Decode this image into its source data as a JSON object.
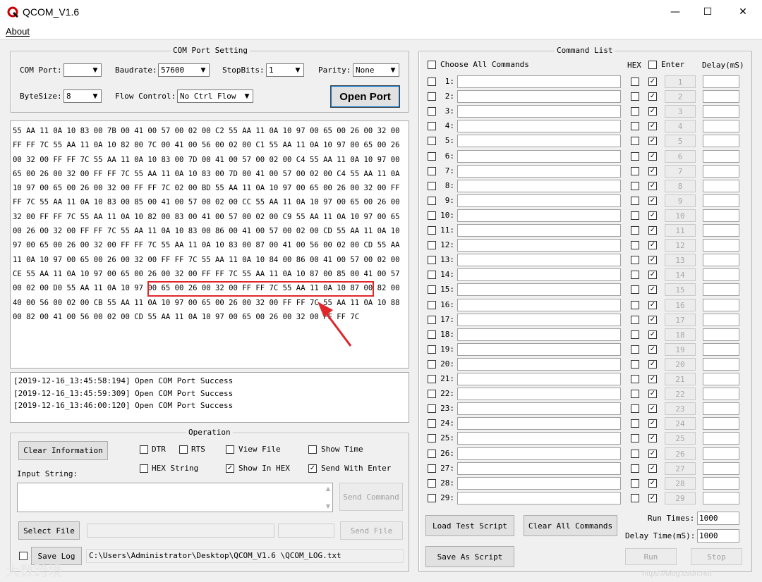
{
  "window": {
    "title": "QCOM_V1.6",
    "minimize": "—",
    "maximize": "☐",
    "close": "✕"
  },
  "menu": {
    "about": "About"
  },
  "com_setting": {
    "group_title": "COM Port Setting",
    "com_port_label": "COM Port:",
    "com_port_value": "",
    "baudrate_label": "Baudrate:",
    "baudrate_value": "57600",
    "stopbits_label": "StopBits:",
    "stopbits_value": "1",
    "parity_label": "Parity:",
    "parity_value": "None",
    "bytesize_label": "ByteSize:",
    "bytesize_value": "8",
    "flow_label": "Flow Control:",
    "flow_value": "No Ctrl Flow",
    "open_button": "Open Port"
  },
  "receive": {
    "lines": [
      "55 AA 11 0A 10 83 00 7B 00 41 00 57 00 02 00 C2 55 AA 11 0A 10 97 00 65 00 26 00 32 00",
      "FF FF 7C 55 AA 11 0A 10 82 00 7C 00 41 00 56 00 02 00 C1 55 AA 11 0A 10 97 00 65 00 26",
      "00 32 00 FF FF 7C 55 AA 11 0A 10 83 00 7D 00 41 00 57 00 02 00 C4 55 AA 11 0A 10 97 00",
      "65 00 26 00 32 00 FF FF 7C 55 AA 11 0A 10 83 00 7D 00 41 00 57 00 02 00 C4 55 AA 11 0A",
      "10 97 00 65 00 26 00 32 00 FF FF 7C 02 00 BD 55 AA 11 0A 10 97 00 65 00 26 00 32 00 FF",
      "FF 7C 55 AA 11 0A 10 83 00 85 00 41 00 57 00 02 00 CC 55 AA 11 0A 10 97 00 65 00 26 00",
      "32 00 FF FF 7C 55 AA 11 0A 10 82 00 83 00 41 00 57 00 02 00 C9 55 AA 11 0A 10 97 00 65",
      "00 26 00 32 00 FF FF 7C 55 AA 11 0A 10 83 00 86 00 41 00 57 00 02 00 CD 55 AA 11 0A 10",
      "97 00 65 00 26 00 32 00 FF FF 7C 55 AA 11 0A 10 83 00 87 00 41 00 56 00 02 00 CD 55 AA",
      "11 0A 10 97 00 65 00 26 00 32 00 FF FF 7C 55 AA 11 0A 10 84 00 86 00 41 00 57 00 02 00",
      "CE 55 AA 11 0A 10 97 00 65 00 26 00 32 00 FF FF 7C 55 AA 11 0A 10 87 00 85 00 41 00 57",
      "00 02 00 D0 55 AA 11 0A 10 97 00 65 00 26 00 32 00 FF FF 7C 55 AA 11 0A 10 87 00 82 00",
      "40 00 56 00 02 00 CB 55 AA 11 0A 10 97 00 65 00 26 00 32 00 FF FF 7C 55 AA 11 0A 10 88",
      "00 82 00 41 00 56 00 02 00 CD 55 AA 11 0A 10 97 00 65 00 26 00 32 00 FF FF 7C"
    ],
    "highlight_color": "#e0262a"
  },
  "log": {
    "lines": [
      "[2019-12-16_13:45:58:194] Open COM Port Success",
      "[2019-12-16_13:45:59:309] Open COM Port Success",
      "[2019-12-16_13:46:00:120] Open COM Port Success"
    ]
  },
  "operation": {
    "group_title": "Operation",
    "clear_button": "Clear Information",
    "dtr": "DTR",
    "rts": "RTS",
    "view_file": "View File",
    "show_time": "Show Time",
    "hex_string": "HEX String",
    "show_in_hex": "Show In HEX",
    "send_with_enter": "Send With Enter",
    "input_label": "Input String:",
    "send_command": "Send Command",
    "select_file": "Select File",
    "send_file": "Send File",
    "save_log": "Save Log",
    "log_path": "C:\\Users\\Administrator\\Desktop\\QCOM_V1.6 \\QCOM_LOG.txt"
  },
  "command_list": {
    "group_title": "Command List",
    "choose_all": "Choose All Commands",
    "hex_header": "HEX",
    "enter_header": "Enter",
    "delay_header": "Delay(mS)",
    "rows": [
      "1:",
      "2:",
      "3:",
      "4:",
      "5:",
      "6:",
      "7:",
      "8:",
      "9:",
      "10:",
      "11:",
      "12:",
      "13:",
      "14:",
      "15:",
      "16:",
      "17:",
      "18:",
      "19:",
      "20:",
      "21:",
      "22:",
      "23:",
      "24:",
      "25:",
      "26:",
      "27:",
      "28:",
      "29:"
    ],
    "row_buttons": [
      "1",
      "2",
      "3",
      "4",
      "5",
      "6",
      "7",
      "8",
      "9",
      "10",
      "11",
      "12",
      "13",
      "14",
      "15",
      "16",
      "17",
      "18",
      "19",
      "20",
      "21",
      "22",
      "23",
      "24",
      "25",
      "26",
      "27",
      "28",
      "29"
    ],
    "load_script": "Load Test Script",
    "clear_all": "Clear All Commands",
    "save_script": "Save As Script",
    "run_times_label": "Run Times:",
    "run_times_value": "1000",
    "delay_time_label": "Delay Time(mS):",
    "delay_time_value": "1000",
    "run": "Run",
    "stop": "Stop"
  },
  "watermark": {
    "left": "大数跨境",
    "right": "https://blog.csdn.net"
  }
}
